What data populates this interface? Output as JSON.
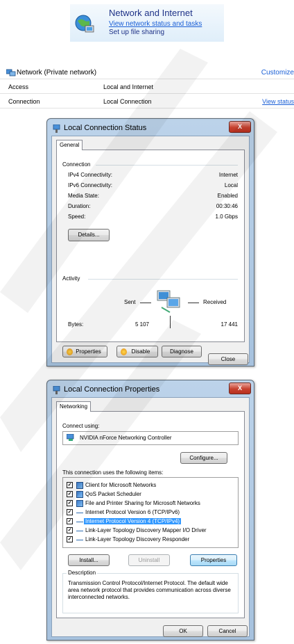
{
  "banner": {
    "title": "Network and Internet",
    "link1": "View network status and tasks",
    "link2": "Set up file sharing"
  },
  "network": {
    "name": "Network (Private network)",
    "customize": "Customize",
    "access_label": "Access",
    "access_value": "Local and Internet",
    "connection_label": "Connection",
    "connection_value": "Local Connection",
    "view_status": "View status"
  },
  "status_window": {
    "title": "Local Connection Status",
    "tab": "General",
    "connection_group": "Connection",
    "rows": [
      {
        "label": "IPv4 Connectivity:",
        "value": "Internet"
      },
      {
        "label": "IPv6 Connectivity:",
        "value": "Local"
      },
      {
        "label": "Media State:",
        "value": "Enabled"
      },
      {
        "label": "Duration:",
        "value": "00:30:46"
      },
      {
        "label": "Speed:",
        "value": "1.0 Gbps"
      }
    ],
    "details_button": "Details...",
    "activity_group": "Activity",
    "sent_label": "Sent",
    "received_label": "Received",
    "bytes_label": "Bytes:",
    "bytes_sent": "5 107",
    "bytes_received": "17 441",
    "properties_button": "Properties",
    "disable_button": "Disable",
    "diagnose_button": "Diagnose",
    "close_button": "Close",
    "close_glyph": "X"
  },
  "props_window": {
    "title": "Local Connection Properties",
    "tab": "Networking",
    "connect_using": "Connect using:",
    "adapter": "NVIDIA nForce Networking Controller",
    "configure_button": "Configure...",
    "items_label": "This connection uses the following items:",
    "items": [
      {
        "label": "Client for Microsoft Networks",
        "checked": true
      },
      {
        "label": "QoS Packet Scheduler",
        "checked": true
      },
      {
        "label": "File and Printer Sharing for Microsoft Networks",
        "checked": true
      },
      {
        "label": "Internet Protocol Version 6 (TCP/IPv6)",
        "checked": true
      },
      {
        "label": "Internet Protocol Version 4 (TCP/IPv4)",
        "checked": true,
        "selected": true
      },
      {
        "label": "Link-Layer Topology Discovery Mapper I/O Driver",
        "checked": true
      },
      {
        "label": "Link-Layer Topology Discovery Responder",
        "checked": true
      }
    ],
    "install_button": "Install...",
    "uninstall_button": "Uninstall",
    "properties_button": "Properties",
    "description_label": "Description",
    "description_text": "Transmission Control Protocol/Internet Protocol. The default wide area network protocol that provides communication across diverse interconnected networks.",
    "ok_button": "OK",
    "cancel_button": "Cancel",
    "close_glyph": "X",
    "check_glyph": "✓"
  },
  "colors": {
    "link": "#1a5fd6",
    "title_blue": "#1e3287",
    "selection": "#3399ff"
  }
}
